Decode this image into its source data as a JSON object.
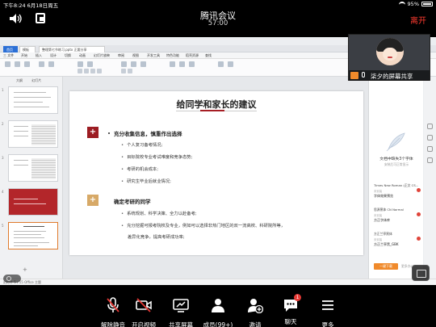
{
  "status_bar": {
    "time_date": "下午8:24  6月18日周五",
    "battery": "95%"
  },
  "meeting": {
    "title": "腾讯会议",
    "timer": "57:00",
    "leave_label": "离开"
  },
  "shared_screen": {
    "tabs": [
      "首页",
      "模板",
      "整理第七节练习.pptx  正要分享"
    ],
    "menus": [
      "三 文件",
      "开始",
      "插入",
      "设计",
      "切换",
      "动画",
      "幻灯片放映",
      "审阅",
      "视图",
      "开发工具",
      "特色功能",
      "稻壳资源",
      "查找"
    ],
    "thumb_tabs": [
      "大纲",
      "幻灯片"
    ],
    "thumb_numbers": [
      "1",
      "2",
      "3",
      "4",
      "5"
    ],
    "slide": {
      "title": "给同学和家长的建议",
      "section1": {
        "marker": "+",
        "heading": "充分收集信息，慎重作出选择",
        "bullets": [
          "个人复习备考情况;",
          "目标院校专业考试难度和竞争态势;",
          "考研的机会成本;",
          "研究生毕业后就业情况;"
        ]
      },
      "section2": {
        "marker": "+",
        "heading": "确定考研的同学",
        "bullets": [
          "系统规划、科学决策、全力以赴备考;",
          "充分挖掘可报考院校及专业，例如可以选择非热门地区的双一流高校、科研院所等，",
          "差异化竞争，提高考研成功率;"
        ]
      }
    },
    "right_panel": {
      "header": "文档中缺失3个字体",
      "sub": "安装后可正常显示",
      "fonts": [
        {
          "name": "Times New Roman (正文 CS...",
          "status": "未安装",
          "sample": "字体效果预览"
        },
        {
          "name": "思源黑体 CN Normal",
          "status": "未安装",
          "sample": "方正字体库"
        },
        {
          "name": "方正兰亭黑体",
          "status": "未安装",
          "sample": "方正兰亭黑_GBK"
        }
      ],
      "install_label": "一键下载",
      "more_label": "更多办公"
    },
    "statusbar_text": "幻灯片 5 / 15    Office 主题"
  },
  "participant": {
    "name": "柒夕的屏幕共享"
  },
  "toolbar": [
    {
      "id": "mute",
      "icon": "mic-muted-icon",
      "label": "解除静音"
    },
    {
      "id": "video",
      "icon": "camera-off-icon",
      "label": "开启视频"
    },
    {
      "id": "share",
      "icon": "share-screen-icon",
      "label": "共享屏幕"
    },
    {
      "id": "members",
      "icon": "members-icon",
      "label": "成员(99+)"
    },
    {
      "id": "invite",
      "icon": "invite-icon",
      "label": "邀请"
    },
    {
      "id": "chat",
      "icon": "chat-icon",
      "label": "聊天",
      "badge": "1"
    },
    {
      "id": "more",
      "icon": "more-icon",
      "label": "更多"
    }
  ],
  "colors": {
    "accent_red": "#9c1c22",
    "accent_gold": "#d7a967",
    "leave_red": "#ff3b30",
    "install_orange": "#f08a2b"
  }
}
